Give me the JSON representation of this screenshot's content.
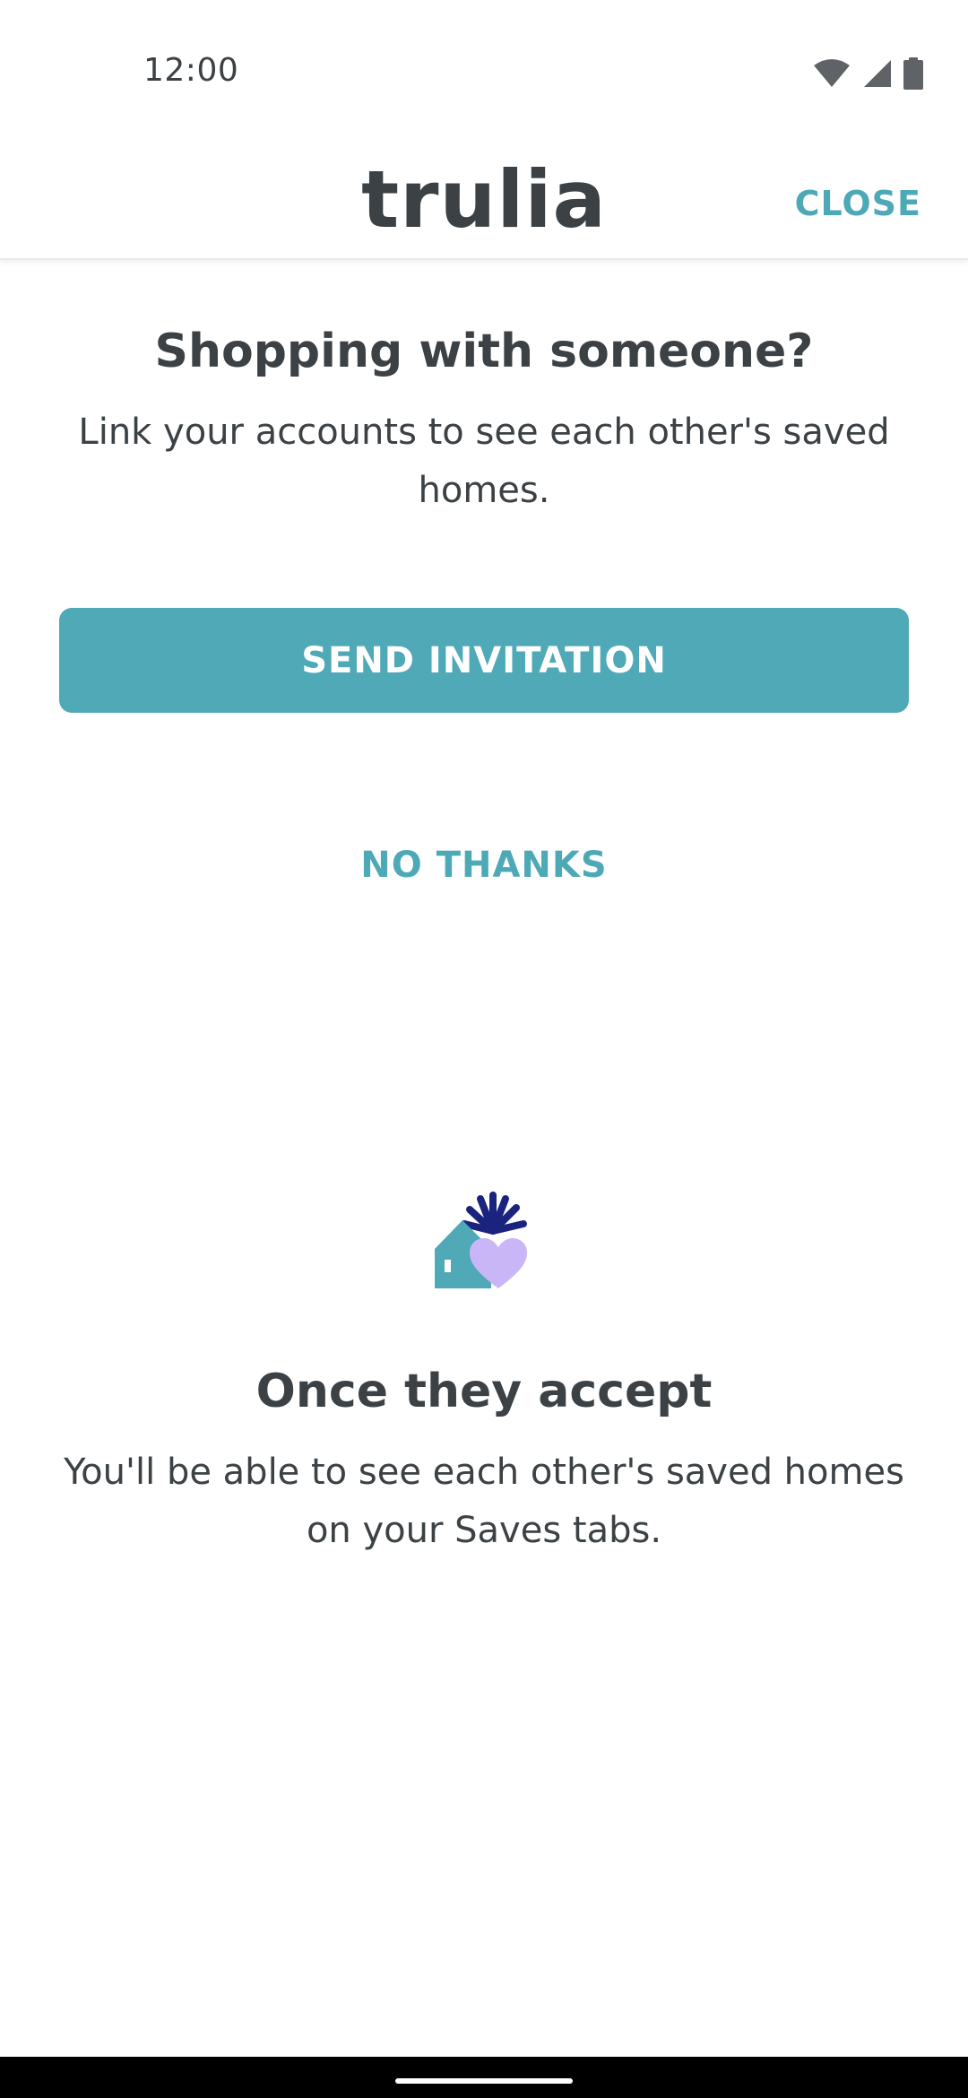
{
  "status_bar": {
    "time": "12:00",
    "icons": [
      "wifi-icon",
      "cell-signal-icon",
      "battery-icon"
    ]
  },
  "header": {
    "logo": "trulia",
    "close_label": "CLOSE"
  },
  "invite": {
    "title": "Shopping with someone?",
    "description": "Link your accounts to see each other's saved homes.",
    "send_label": "SEND INVITATION",
    "decline_label": "NO THANKS"
  },
  "accept_info": {
    "illustration": "house-heart-illustration",
    "title": "Once they accept",
    "description": "You'll be able to see each other's saved homes on your Saves tabs."
  },
  "colors": {
    "accent": "#4fa9b7",
    "text": "#3b4144",
    "illustration_navy": "#1a237e",
    "illustration_lavender": "#c9b6f7"
  }
}
